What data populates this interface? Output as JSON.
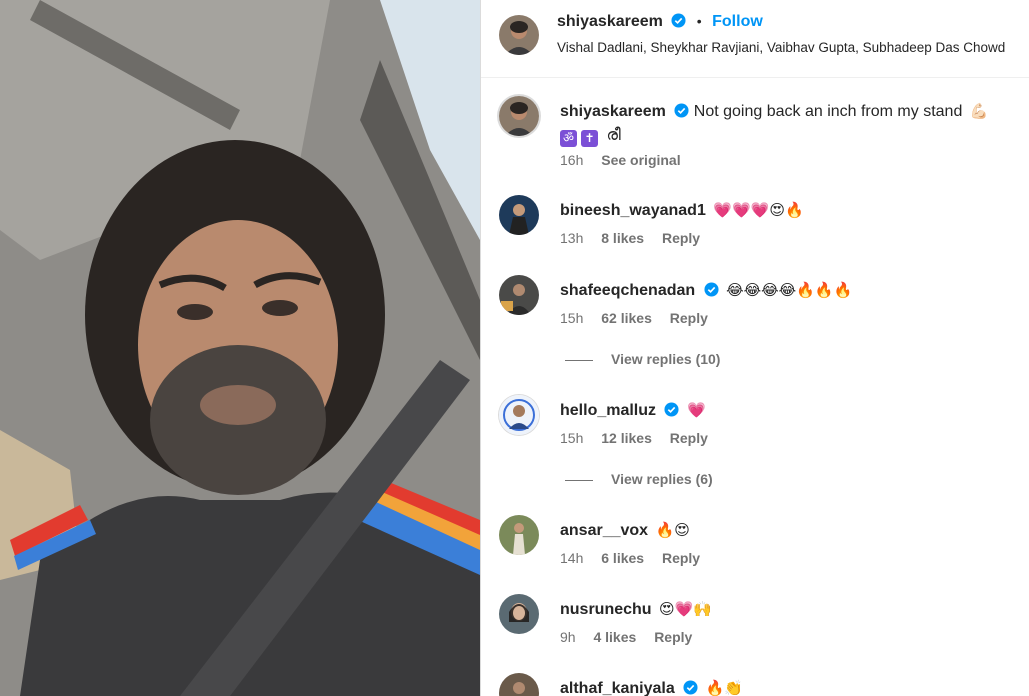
{
  "post": {
    "author": "shiyaskareem",
    "follow_label": "Follow",
    "separator": "•",
    "collaborators": "Vishal Dadlani, Sheykhar Ravjiani, Vaibhav Gupta, Subhadeep Das Chowd"
  },
  "caption": {
    "username": "shiyaskareem",
    "text": "Not going back an inch from my stand",
    "emoji": "💪🏻",
    "symbols": [
      "ॐ",
      "✝"
    ],
    "script_text": "രീ",
    "time": "16h",
    "see_original": "See original"
  },
  "comments": [
    {
      "username": "bineesh_wayanad1",
      "verified": false,
      "text": "💗💗💗😍🔥",
      "time": "13h",
      "likes": "8 likes",
      "reply": "Reply"
    },
    {
      "username": "shafeeqchenadan",
      "verified": true,
      "text": "😂😂😂😂🔥🔥🔥",
      "time": "15h",
      "likes": "62 likes",
      "reply": "Reply",
      "view_replies": "View replies (10)"
    },
    {
      "username": "hello_malluz",
      "verified": true,
      "text": "💗",
      "time": "15h",
      "likes": "12 likes",
      "reply": "Reply",
      "view_replies": "View replies (6)"
    },
    {
      "username": "ansar__vox",
      "verified": false,
      "text": "🔥😍",
      "time": "14h",
      "likes": "6 likes",
      "reply": "Reply"
    },
    {
      "username": "nusrunechu",
      "verified": false,
      "text": "😍💗🙌",
      "time": "9h",
      "likes": "4 likes",
      "reply": "Reply"
    },
    {
      "username": "althaf_kaniyala",
      "verified": true,
      "text": "🔥👏",
      "time": "",
      "likes": "",
      "reply": ""
    }
  ],
  "colors": {
    "link_blue": "#0095f6",
    "verified_blue": "#0095f6",
    "meta_gray": "#737373",
    "heart_pink": "#e7306c"
  },
  "icons": [
    "verified-badge-icon",
    "profile-avatar"
  ]
}
